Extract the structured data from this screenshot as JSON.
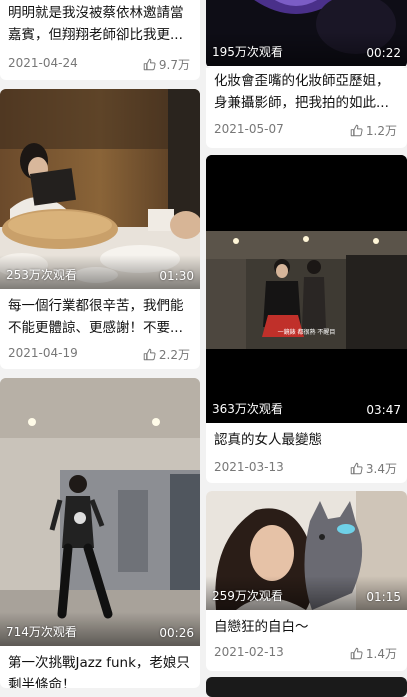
{
  "colors": {
    "background": "#f2f2f2",
    "card": "#ffffff",
    "meta_text": "#777777"
  },
  "cards": [
    {
      "title": "明明就是我沒被蔡依林邀請當嘉賓，但翔翔老師卻比我更...",
      "views": "",
      "duration": "",
      "date": "2021-04-24",
      "likes": "9.7万"
    },
    {
      "title": "",
      "views": "195万次观看",
      "duration": "00:22",
      "date": "",
      "likes": ""
    },
    {
      "title": "化妝會歪嘴的化妝師亞歷姐，身兼攝影師，把我拍的如此...",
      "views": "",
      "duration": "",
      "date": "2021-05-07",
      "likes": "1.2万"
    },
    {
      "title": "每一個行業都很辛苦，我們能不能更體諒、更感謝！不要...",
      "views": "253万次观看",
      "duration": "01:30",
      "date": "2021-04-19",
      "likes": "2.2万"
    },
    {
      "title": "認真的女人最變態",
      "views": "363万次观看",
      "duration": "03:47",
      "date": "2021-03-13",
      "likes": "3.4万",
      "caption": "一鏡錶 都很熟 不醒目"
    },
    {
      "title": "第一次挑戰Jazz funk，老娘只剩半條命！",
      "views": "714万次观看",
      "duration": "00:26",
      "date": "",
      "likes": ""
    },
    {
      "title": "自戀狂的自白～",
      "views": "259万次观看",
      "duration": "01:15",
      "date": "2021-02-13",
      "likes": "1.4万"
    }
  ]
}
